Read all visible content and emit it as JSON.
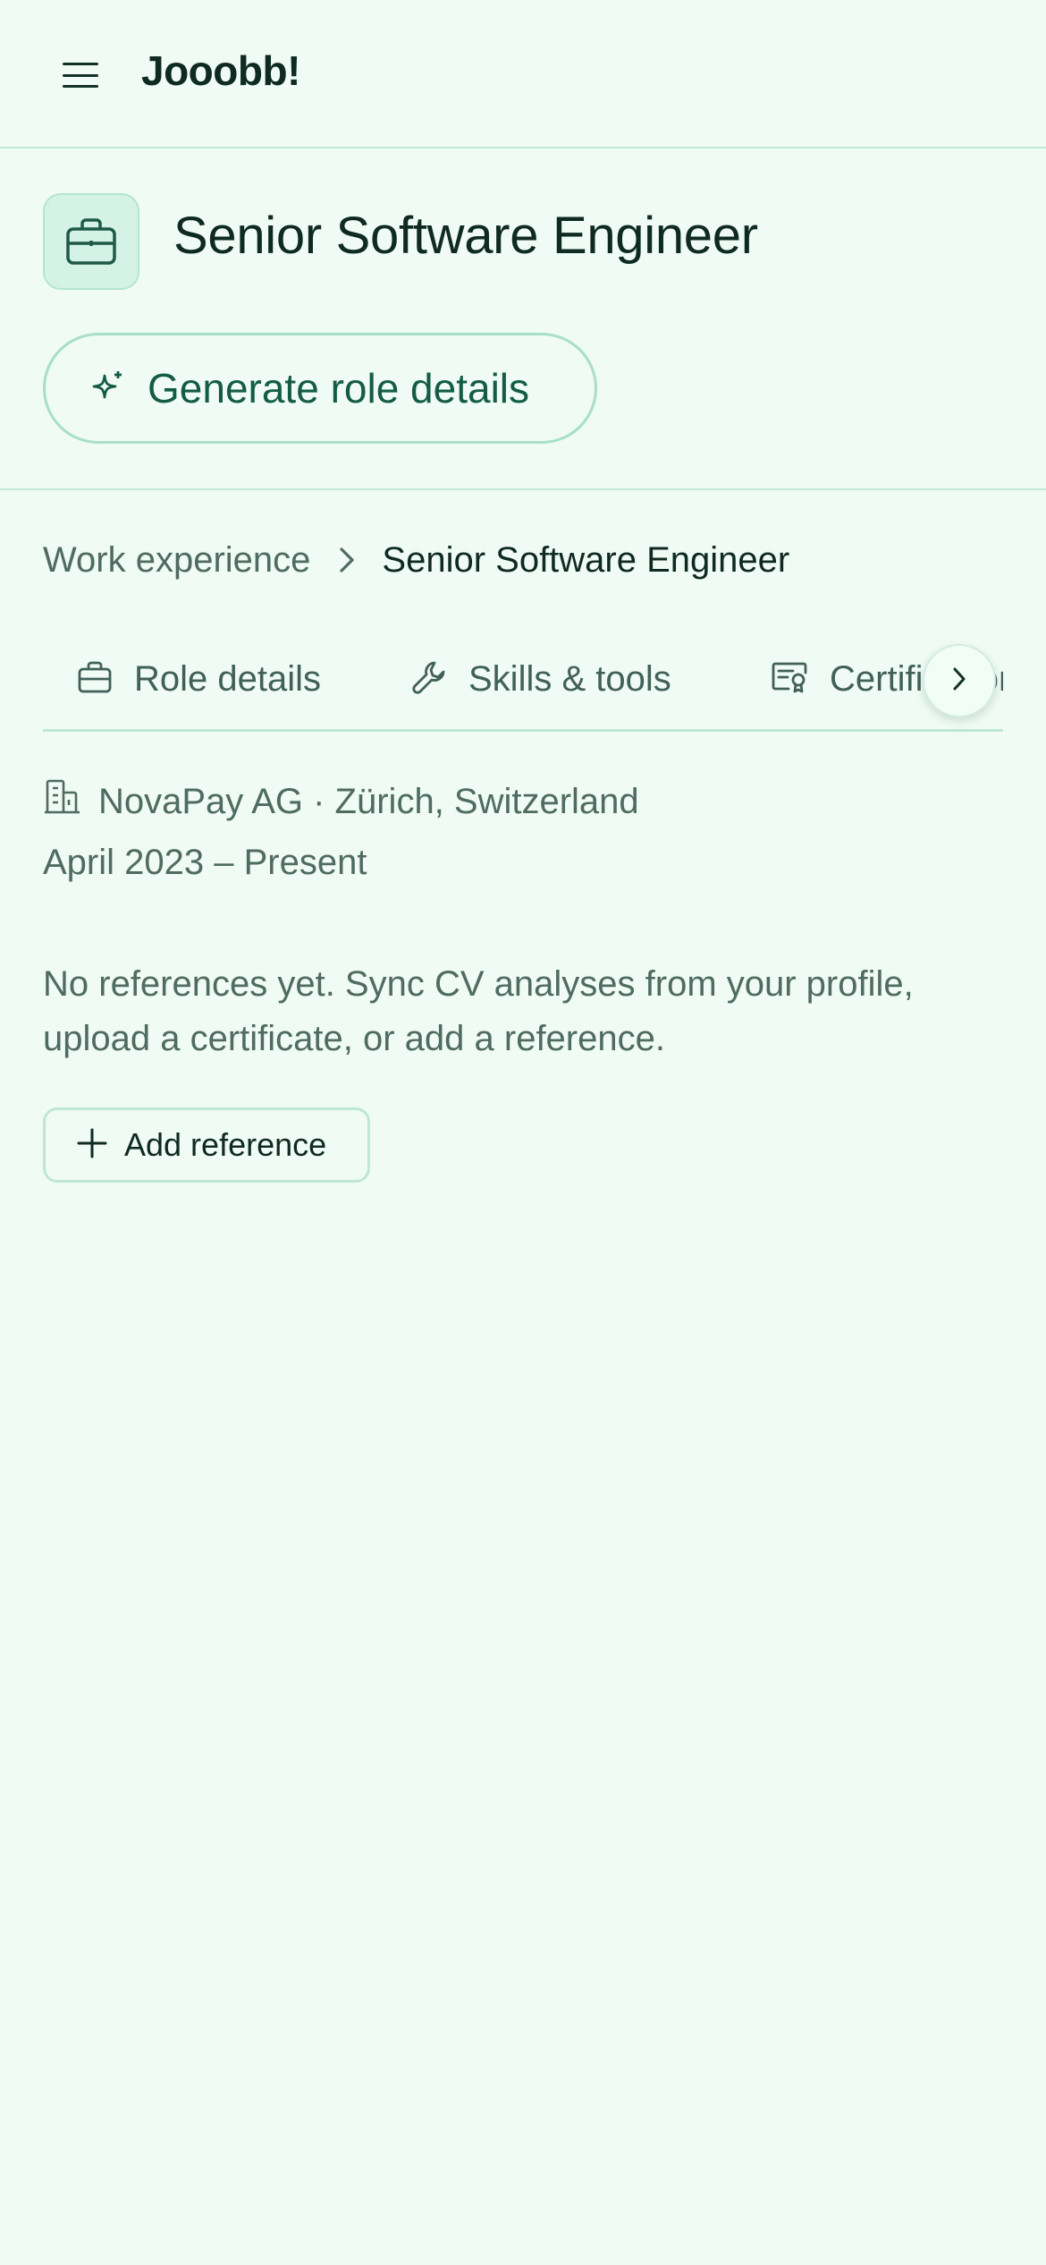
{
  "app": {
    "brand": "Jooobb!"
  },
  "header": {
    "menu_icon": "hamburger-menu-icon"
  },
  "role": {
    "title": "Senior Software Engineer",
    "icon": "briefcase-icon",
    "generate_label": "Generate role details",
    "generate_icon": "sparkle-icon"
  },
  "breadcrumb": {
    "parent": "Work experience",
    "current": "Senior Software Engineer"
  },
  "tabs": [
    {
      "label": "Role details",
      "icon": "briefcase-icon"
    },
    {
      "label": "Skills & tools",
      "icon": "wrench-icon"
    },
    {
      "label": "Certifications",
      "icon": "certificate-icon"
    }
  ],
  "details": {
    "company_line": "NovaPay AG · Zürich, Switzerland",
    "dates": "April 2023 – Present",
    "empty_message": "No references yet. Sync CV analyses from your profile, upload a certificate, or add a reference.",
    "add_reference_label": "Add reference"
  },
  "colors": {
    "background": "#effbf4",
    "accent": "#145c46",
    "border": "#bfe6d6",
    "muted_text": "#4f6b62"
  }
}
